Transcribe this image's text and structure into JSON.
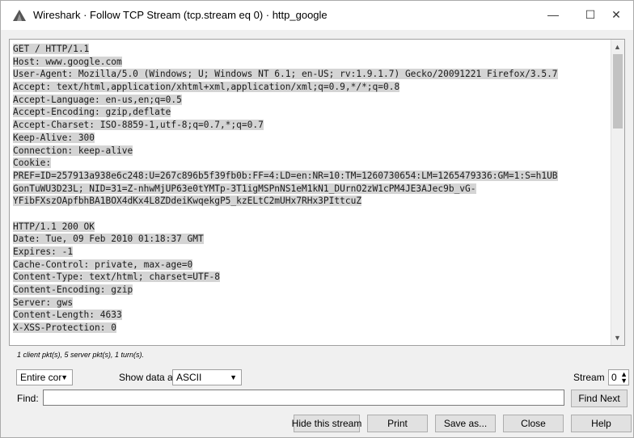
{
  "window": {
    "title": "Wireshark · Follow TCP Stream (tcp.stream eq 0) · http_google",
    "controls": {
      "minimize": "—",
      "maximize": "☐",
      "close": "✕"
    }
  },
  "stream": {
    "lines": [
      {
        "text": "GET / HTTP/1.1",
        "side": "client"
      },
      {
        "text": "Host: www.google.com",
        "side": "client"
      },
      {
        "text": "User-Agent: Mozilla/5.0 (Windows; U; Windows NT 6.1; en-US; rv:1.9.1.7) Gecko/20091221 Firefox/3.5.7",
        "side": "client"
      },
      {
        "text": "Accept: text/html,application/xhtml+xml,application/xml;q=0.9,*/*;q=0.8",
        "side": "client"
      },
      {
        "text": "Accept-Language: en-us,en;q=0.5",
        "side": "client"
      },
      {
        "text": "Accept-Encoding: gzip,deflate",
        "side": "client"
      },
      {
        "text": "Accept-Charset: ISO-8859-1,utf-8;q=0.7,*;q=0.7",
        "side": "client"
      },
      {
        "text": "Keep-Alive: 300",
        "side": "client"
      },
      {
        "text": "Connection: keep-alive",
        "side": "client"
      },
      {
        "text": "Cookie:",
        "side": "client"
      },
      {
        "text": "PREF=ID=257913a938e6c248:U=267c896b5f39fb0b:FF=4:LD=en:NR=10:TM=1260730654:LM=1265479336:GM=1:S=h1UB",
        "side": "client"
      },
      {
        "text": "GonTuWU3D23L; NID=31=Z-nhwMjUP63e0tYMTp-3T1igMSPnNS1eM1kN1_DUrnO2zW1cPM4JE3AJec9b_vG-",
        "side": "client"
      },
      {
        "text": "YFibFXszOApfbhBA1BOX4dKx4L8ZDdeiKwqekgP5_kzELtC2mUHx7RHx3PIttcuZ",
        "side": "client"
      },
      {
        "text": "",
        "side": "blank"
      },
      {
        "text": "HTTP/1.1 200 OK",
        "side": "server"
      },
      {
        "text": "Date: Tue, 09 Feb 2010 01:18:37 GMT",
        "side": "server"
      },
      {
        "text": "Expires: -1",
        "side": "server"
      },
      {
        "text": "Cache-Control: private, max-age=0",
        "side": "server"
      },
      {
        "text": "Content-Type: text/html; charset=UTF-8",
        "side": "server"
      },
      {
        "text": "Content-Encoding: gzip",
        "side": "server"
      },
      {
        "text": "Server: gws",
        "side": "server"
      },
      {
        "text": "Content-Length: 4633",
        "side": "server"
      },
      {
        "text": "X-XSS-Protection: 0",
        "side": "server"
      }
    ]
  },
  "summary": "1 client pkt(s), 5 server pkt(s), 1 turn(s).",
  "controls": {
    "conversation_select": "Entire cor",
    "show_data_label": "Show data as",
    "show_data_select": "ASCII",
    "stream_label": "Stream",
    "stream_value": "0",
    "find_label": "Find:",
    "find_value": "",
    "find_next": "Find Next",
    "hide_stream": "Hide this stream",
    "print": "Print",
    "save_as": "Save as...",
    "close": "Close",
    "help": "Help"
  },
  "colors": {
    "highlight": "#d4d4d4",
    "background": "#f0f0f0"
  },
  "icons": {
    "app": "wireshark-fin-icon",
    "scroll_up": "chevron-up-icon",
    "scroll_down": "chevron-down-icon",
    "dropdown": "caret-down-icon",
    "spin": "spin-updown-icon"
  }
}
